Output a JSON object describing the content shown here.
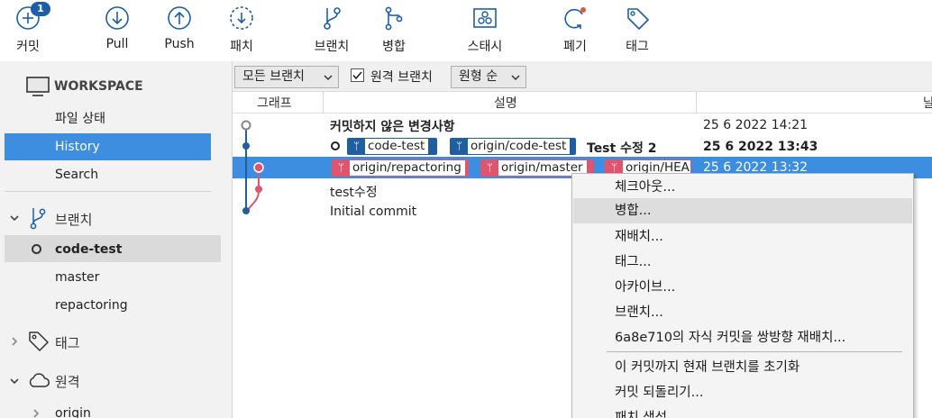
{
  "toolbar": {
    "commit": {
      "label": "커밋",
      "badge": "1"
    },
    "pull": {
      "label": "Pull"
    },
    "push": {
      "label": "Push"
    },
    "patch": {
      "label": "패치"
    },
    "branch": {
      "label": "브랜치"
    },
    "merge": {
      "label": "병합"
    },
    "stash": {
      "label": "스태시"
    },
    "discard": {
      "label": "폐기"
    },
    "tag": {
      "label": "태그"
    }
  },
  "sidebar": {
    "workspace_title": "WORKSPACE",
    "workspace_items": [
      "파일 상태",
      "History",
      "Search"
    ],
    "branches_title": "브랜치",
    "branches": [
      {
        "name": "code-test",
        "current": true
      },
      {
        "name": "master",
        "current": false
      },
      {
        "name": "repactoring",
        "current": false
      }
    ],
    "tags_title": "태그",
    "remotes_title": "원격",
    "remotes": [
      "origin"
    ]
  },
  "filter": {
    "branches_dropdown": "모든 브랜치",
    "remote_branches_label": "원격 브랜치",
    "remote_branches_checked": true,
    "order_dropdown": "원형 순"
  },
  "columns": {
    "graph": "그래프",
    "description": "설명",
    "date": "날"
  },
  "history": {
    "uncommitted": {
      "label": "커밋하지 않은 변경사항",
      "date": "25 6 2022 14:21"
    },
    "commit1": {
      "tags": [
        "code-test",
        "origin/code-test"
      ],
      "message": "Test 수정 2",
      "date": "25 6 2022 13:43"
    },
    "commit2": {
      "tags": [
        "origin/repactoring",
        "origin/master",
        "origin/HEAD"
      ],
      "date": "25 6 2022 13:32"
    },
    "commit3": {
      "message": "test수정"
    },
    "commit4": {
      "message": "Initial commit"
    }
  },
  "context_menu": {
    "items": [
      "체크아웃...",
      "병합...",
      "재배치...",
      "태그...",
      "아카이브...",
      "브랜치...",
      "6a8e710의 자식 커밋을 쌍방향 재배치...",
      "이 커밋까지 현재 브랜치를 초기화",
      "커밋 되돌리기...",
      "패치 생성..."
    ]
  },
  "colors": {
    "selection": "#3d8ee0",
    "branch_blue": "#1f5fa0",
    "branch_red": "#e0556d",
    "badge": "#1c5fa8"
  }
}
